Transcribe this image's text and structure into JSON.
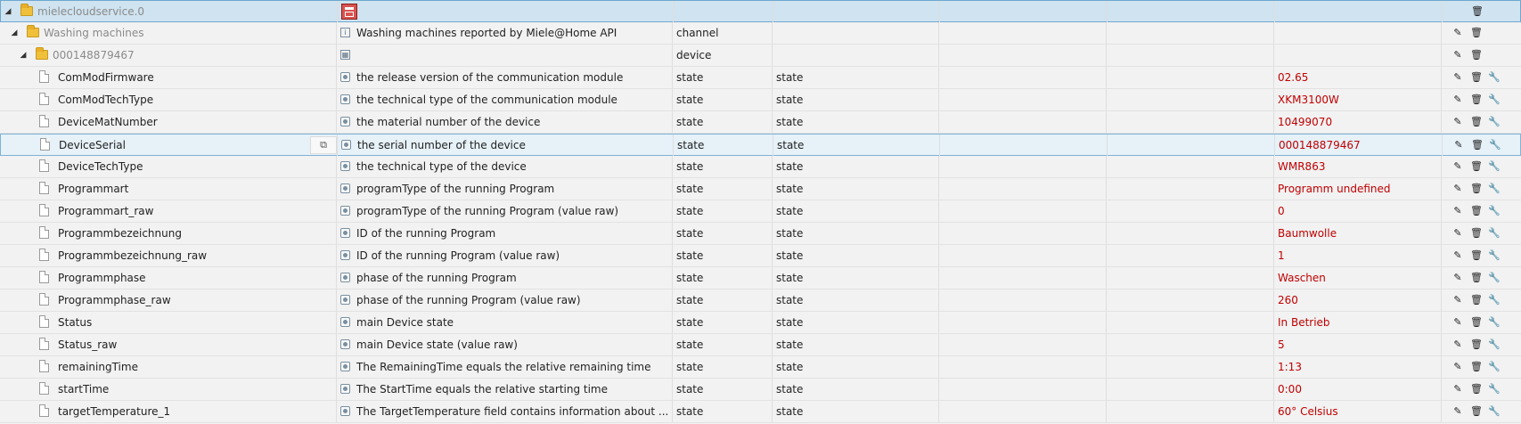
{
  "root": {
    "name": "mielecloudservice.0"
  },
  "channel": {
    "name": "Washing machines",
    "description": "Washing machines reported by Miele@Home API",
    "type": "channel"
  },
  "device": {
    "name": "000148879467",
    "type": "device"
  },
  "states": [
    {
      "name": "ComModFirmware",
      "description": "the release version of the communication module",
      "type": "state",
      "role": "state",
      "value": "02.65"
    },
    {
      "name": "ComModTechType",
      "description": "the technical type of the communication module",
      "type": "state",
      "role": "state",
      "value": "XKM3100W"
    },
    {
      "name": "DeviceMatNumber",
      "description": "the material number of the device",
      "type": "state",
      "role": "state",
      "value": "10499070"
    },
    {
      "name": "DeviceSerial",
      "description": "the serial number of the device",
      "type": "state",
      "role": "state",
      "value": "000148879467"
    },
    {
      "name": "DeviceTechType",
      "description": "the technical type of the device",
      "type": "state",
      "role": "state",
      "value": "WMR863"
    },
    {
      "name": "Programmart",
      "description": "programType of the running Program",
      "type": "state",
      "role": "state",
      "value": "Programm undefined"
    },
    {
      "name": "Programmart_raw",
      "description": "programType of the running Program (value raw)",
      "type": "state",
      "role": "state",
      "value": "0"
    },
    {
      "name": "Programmbezeichnung",
      "description": "ID of the running Program",
      "type": "state",
      "role": "state",
      "value": "Baumwolle"
    },
    {
      "name": "Programmbezeichnung_raw",
      "description": "ID of the running Program (value raw)",
      "type": "state",
      "role": "state",
      "value": "1"
    },
    {
      "name": "Programmphase",
      "description": "phase of the running Program",
      "type": "state",
      "role": "state",
      "value": "Waschen"
    },
    {
      "name": "Programmphase_raw",
      "description": "phase of the running Program (value raw)",
      "type": "state",
      "role": "state",
      "value": "260"
    },
    {
      "name": "Status",
      "description": "main Device state",
      "type": "state",
      "role": "state",
      "value": "In Betrieb"
    },
    {
      "name": "Status_raw",
      "description": "main Device state (value raw)",
      "type": "state",
      "role": "state",
      "value": "5"
    },
    {
      "name": "remainingTime",
      "description": "The RemainingTime equals the relative remaining time",
      "type": "state",
      "role": "state",
      "value": "1:13"
    },
    {
      "name": "startTime",
      "description": "The StartTime equals the relative starting time",
      "type": "state",
      "role": "state",
      "value": "0:00"
    },
    {
      "name": "targetTemperature_1",
      "description": "The TargetTemperature field contains information about ...",
      "type": "state",
      "role": "state",
      "value": "60° Celsius"
    }
  ],
  "selected_index": 3,
  "colors": {
    "value": "#c00000",
    "selection": "#e6f1f8",
    "root_row": "#cfe3f0"
  },
  "icons": {
    "edit": "pencil-icon",
    "delete": "trash-icon",
    "custom": "wrench-icon",
    "copy": "copy-icon",
    "folder": "folder-icon",
    "state": "file-icon"
  }
}
